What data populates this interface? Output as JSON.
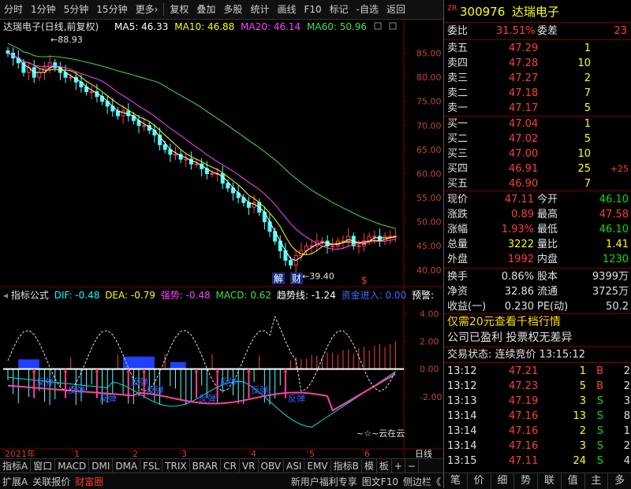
{
  "toolbar": {
    "items": [
      "分时",
      "1分钟",
      "5分钟",
      "15分钟",
      "更多›",
      "复权",
      "叠加",
      "多股",
      "统计",
      "画线",
      "F10",
      "标记",
      "-自选",
      "返回"
    ]
  },
  "chart": {
    "stock_title": "达瑞电子(日线,前复权)",
    "ma5_label": "MA5: 46.33",
    "ma10_label": "MA10: 46.88",
    "ma20_label": "MA20: 46.14",
    "ma60_label": "MA60: 50.96",
    "high_marker": "88.93",
    "low_marker": "39.40",
    "price_ticks": [
      "85.00",
      "80.00",
      "75.00",
      "70.00",
      "65.00",
      "60.00",
      "55.00",
      "50.00",
      "45.00",
      "40.00"
    ],
    "event_jie": "解",
    "event_cai": "财",
    "event_s": "$",
    "colors": {
      "ma5": "#ffffff",
      "ma10": "#ffff00",
      "ma20": "#ff40ff",
      "ma60": "#40e040",
      "up": "#ff3b3b",
      "down": "#54ffff"
    }
  },
  "indicator": {
    "name": "指标公式",
    "dif": "DIF: -0.48",
    "dea": "DEA: -0.79",
    "qiangshi": "强势: -0.48",
    "macd": "MACD: 0.62",
    "trend": "趋势线: -1.24",
    "fund": "资金进入: 0.00",
    "warning": "预警:",
    "ticks": [
      "4.00",
      "2.00",
      "0.00",
      "-2.00"
    ],
    "signals": [
      "反弹",
      "反弹",
      "反弹",
      "反弹",
      "反弹",
      "反弹",
      "反弹",
      "反弹",
      "反弹"
    ],
    "watermark": "~☆~云在云"
  },
  "timeaxis": {
    "labels": [
      "2021年",
      "1",
      "2",
      "3",
      "4",
      "5",
      "6"
    ],
    "period": "日线"
  },
  "tabs": [
    "指标A",
    "窗口",
    "MACD",
    "DMI",
    "DMA",
    "FSL",
    "TRIX",
    "BRAR",
    "CR",
    "VR",
    "OBV",
    "ASI",
    "EMV",
    "指标B",
    "模",
    "板",
    "+",
    "−"
  ],
  "status": [
    "扩展A",
    "关联报价",
    "财富圈",
    "新用户福利专享",
    "图文F10",
    "侧边栏《"
  ],
  "quote": {
    "zr": "ZR",
    "code": "300976",
    "name": "达瑞电子",
    "weibi_label": "委比",
    "weibi": "31.51%",
    "weicha_label": "委差",
    "weicha": "23",
    "asks": [
      {
        "label": "卖五",
        "price": "47.29",
        "vol": "1"
      },
      {
        "label": "卖四",
        "price": "47.28",
        "vol": "10"
      },
      {
        "label": "卖三",
        "price": "47.27",
        "vol": "2"
      },
      {
        "label": "卖二",
        "price": "47.18",
        "vol": "7"
      },
      {
        "label": "卖一",
        "price": "47.17",
        "vol": "5"
      }
    ],
    "bids": [
      {
        "label": "买一",
        "price": "47.04",
        "vol": "1",
        "chg": ""
      },
      {
        "label": "买二",
        "price": "47.02",
        "vol": "5",
        "chg": ""
      },
      {
        "label": "买三",
        "price": "47.00",
        "vol": "10",
        "chg": ""
      },
      {
        "label": "买四",
        "price": "46.91",
        "vol": "25",
        "chg": "+25"
      },
      {
        "label": "买五",
        "price": "46.90",
        "vol": "7",
        "chg": ""
      }
    ],
    "stats": [
      {
        "l1": "现价",
        "v1": "47.11",
        "l2": "今开",
        "v2": "46.10"
      },
      {
        "l1": "涨跌",
        "v1": "0.89",
        "l2": "最高",
        "v2": "47.58"
      },
      {
        "l1": "涨幅",
        "v1": "1.93%",
        "l2": "最低",
        "v2": "46.10"
      },
      {
        "l1": "总量",
        "v1": "3222",
        "l2": "量比",
        "v2": "1.41"
      },
      {
        "l1": "外盘",
        "v1": "1992",
        "l2": "内盘",
        "v2": "1230"
      }
    ],
    "stats2": [
      {
        "l1": "换手",
        "v1": "0.86%",
        "l2": "股本",
        "v2": "9399万"
      },
      {
        "l1": "净资",
        "v1": "32.86",
        "l2": "流通",
        "v2": "3725万"
      },
      {
        "l1": "收益(一)",
        "v1": "0.230",
        "l2": "PE(动)",
        "v2": "50.2"
      }
    ],
    "promo1": "仅需20元查看千档行情",
    "promo2": "公司已盈利 投票权无差异",
    "trade_state": "交易状态: 连续竞价 13:15:12",
    "ticks": [
      {
        "t": "13:12",
        "p": "47.21",
        "v": "1",
        "s": "B",
        "n": "2"
      },
      {
        "t": "13:12",
        "p": "47.23",
        "v": "5",
        "s": "B",
        "n": "2"
      },
      {
        "t": "13:13",
        "p": "47.19",
        "v": "3",
        "s": "S",
        "n": "3"
      },
      {
        "t": "13:14",
        "p": "47.16",
        "v": "13",
        "s": "S",
        "n": "8"
      },
      {
        "t": "13:14",
        "p": "47.16",
        "v": "2",
        "s": "S",
        "n": "1"
      },
      {
        "t": "13:14",
        "p": "47.16",
        "v": "3",
        "s": "S",
        "n": "2"
      },
      {
        "t": "13:15",
        "p": "47.11",
        "v": "24",
        "s": "S",
        "n": "4"
      }
    ],
    "bottom_tabs": [
      "笔",
      "价",
      "细",
      "势",
      "联",
      "值",
      "主",
      "多"
    ]
  },
  "chart_data": {
    "type": "candlestick",
    "ma_labels": {
      "ma5": 46.33,
      "ma10": 46.88,
      "ma20": 46.14,
      "ma60": 50.96
    },
    "ylim": [
      38.5,
      89.5
    ],
    "high": 88.93,
    "low": 39.4,
    "close_approx": [
      85,
      84,
      83,
      81,
      82,
      80,
      81,
      82,
      83,
      82,
      81,
      80,
      80,
      79,
      78,
      77,
      77,
      76,
      75,
      74,
      73,
      72,
      73,
      72,
      71,
      70,
      70,
      69,
      68,
      66,
      65,
      64,
      64,
      63,
      63,
      62,
      62,
      61,
      60,
      60,
      60,
      58,
      57,
      56,
      55,
      54,
      53,
      54,
      52,
      50,
      48,
      46,
      44,
      42,
      41,
      43,
      44,
      45,
      45,
      46,
      46,
      45,
      45,
      46,
      46,
      47,
      45,
      45,
      46,
      47,
      47,
      46,
      47,
      47,
      47
    ]
  }
}
